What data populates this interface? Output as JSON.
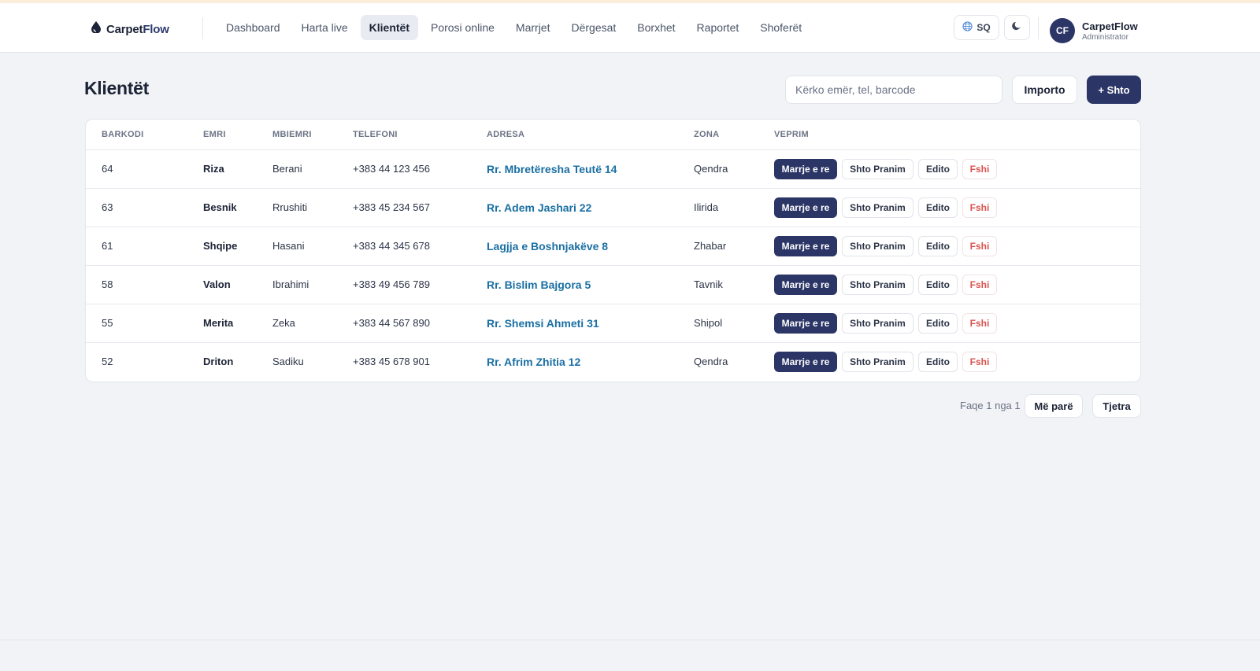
{
  "brand": {
    "name_part1": "Carpet",
    "name_part2": "Flow",
    "icon": "drop-icon"
  },
  "nav": {
    "items": [
      {
        "label": "Dashboard",
        "active": false
      },
      {
        "label": "Harta live",
        "active": false
      },
      {
        "label": "Klientët",
        "active": true
      },
      {
        "label": "Porosi online",
        "active": false
      },
      {
        "label": "Marrjet",
        "active": false
      },
      {
        "label": "Dërgesat",
        "active": false
      },
      {
        "label": "Borxhet",
        "active": false
      },
      {
        "label": "Raportet",
        "active": false
      },
      {
        "label": "Shoferët",
        "active": false
      }
    ]
  },
  "header_right": {
    "language": "SQ",
    "language_icon": "globe-icon",
    "theme_icon": "moon-icon",
    "avatar_initials": "CF",
    "user_name": "CarpetFlow",
    "user_role": "Administrator"
  },
  "page": {
    "title": "Klientët"
  },
  "toolbar": {
    "search_placeholder": "Kërko emër, tel, barcode",
    "search_value": "",
    "import_label": "Importo",
    "add_label": "+ Shto"
  },
  "table": {
    "headers": [
      "BARKODI",
      "EMRI",
      "MBIEMRI",
      "TELEFONI",
      "ADRESA",
      "ZONA",
      "VEPRIM"
    ],
    "actions": {
      "new_pickup": "Marrje e re",
      "add_receipt": "Shto Pranim",
      "edit": "Edito",
      "delete": "Fshi"
    },
    "rows": [
      {
        "barcode": "64",
        "first": "Riza",
        "last": "Berani",
        "phone": "+383 44 123 456",
        "address": "Rr. Mbretëresha Teutë 14",
        "zone": "Qendra"
      },
      {
        "barcode": "63",
        "first": "Besnik",
        "last": "Rrushiti",
        "phone": "+383 45 234 567",
        "address": "Rr. Adem Jashari 22",
        "zone": "Ilirida"
      },
      {
        "barcode": "61",
        "first": "Shqipe",
        "last": "Hasani",
        "phone": "+383 44 345 678",
        "address": "Lagjja e Boshnjakëve 8",
        "zone": "Zhabar"
      },
      {
        "barcode": "58",
        "first": "Valon",
        "last": "Ibrahimi",
        "phone": "+383 49 456 789",
        "address": "Rr. Bislim Bajgora 5",
        "zone": "Tavnik"
      },
      {
        "barcode": "55",
        "first": "Merita",
        "last": "Zeka",
        "phone": "+383 44 567 890",
        "address": "Rr. Shemsi Ahmeti 31",
        "zone": "Shipol"
      },
      {
        "barcode": "52",
        "first": "Driton",
        "last": "Sadiku",
        "phone": "+383 45 678 901",
        "address": "Rr. Afrim Zhitia 12",
        "zone": "Qendra"
      }
    ]
  },
  "pagination": {
    "text": "Faqe 1 nga 1",
    "prev_label": "Më parë",
    "next_label": "Tjetra"
  },
  "colors": {
    "primary": "#2b3566",
    "link": "#1a6fa3",
    "danger": "#d9534f",
    "background": "#f1f3f6"
  }
}
